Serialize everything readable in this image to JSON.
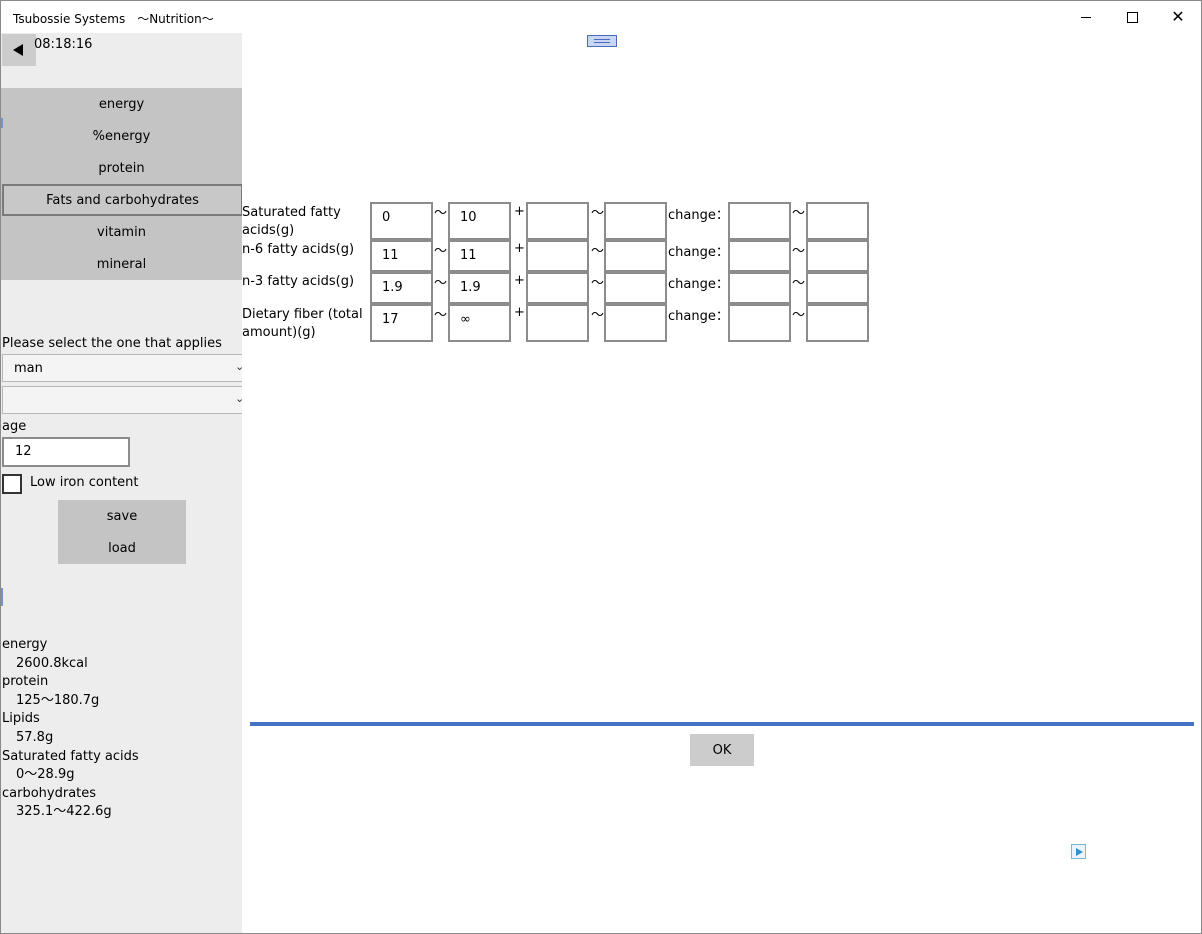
{
  "window": {
    "title": "Tsubossie Systems　〜Nutrition〜"
  },
  "sidebar": {
    "clock": "08:18:16",
    "nav": [
      {
        "label": "energy",
        "active": false
      },
      {
        "label": "%energy",
        "active": false
      },
      {
        "label": "protein",
        "active": false
      },
      {
        "label": "Fats and carbohydrates",
        "active": true
      },
      {
        "label": "vitamin",
        "active": false
      },
      {
        "label": "mineral",
        "active": false
      }
    ],
    "select_label": "Please select the one that applies",
    "sex_value": "man",
    "second_value": "",
    "age_label": "age",
    "age_value": "12",
    "low_iron_label": "Low iron content",
    "low_iron_checked": false,
    "save_label": "save",
    "load_label": "load",
    "summary": [
      {
        "key": "energy",
        "value": "2600.8kcal"
      },
      {
        "key": "protein",
        "value": "125〜180.7g"
      },
      {
        "key": "Lipids",
        "value": "57.8g"
      },
      {
        "key": "Saturated fatty acids",
        "value": "0〜28.9g"
      },
      {
        "key": "carbohydrates",
        "value": "325.1〜422.6g"
      }
    ]
  },
  "main": {
    "tilde": "〜",
    "plus": "+",
    "change_label": "change：",
    "rows": [
      {
        "label": "Saturated fatty acids(g)",
        "min": "0",
        "max": "10",
        "add_min": "",
        "add_max": "",
        "change_min": "",
        "change_max": ""
      },
      {
        "label": "n-6 fatty acids(g)",
        "min": "11",
        "max": "11",
        "add_min": "",
        "add_max": "",
        "change_min": "",
        "change_max": ""
      },
      {
        "label": "n-3 fatty acids(g)",
        "min": "1.9",
        "max": "1.9",
        "add_min": "",
        "add_max": "",
        "change_min": "",
        "change_max": ""
      },
      {
        "label": "Dietary fiber (total amount)(g)",
        "min": "17",
        "max": "∞",
        "add_min": "",
        "add_max": "",
        "change_min": "",
        "change_max": ""
      }
    ],
    "ok_label": "OK"
  },
  "colors": {
    "sidebar_bg": "#ededed",
    "nav_bg": "#c4c4c4",
    "divider": "#4472c4"
  },
  "icons": {
    "back": "back-triangle-icon",
    "minimize": "minimize-icon",
    "maximize": "maximize-icon",
    "close": "close-icon",
    "dropdown": "chevron-down-icon",
    "ad": "adchoices-icon"
  }
}
